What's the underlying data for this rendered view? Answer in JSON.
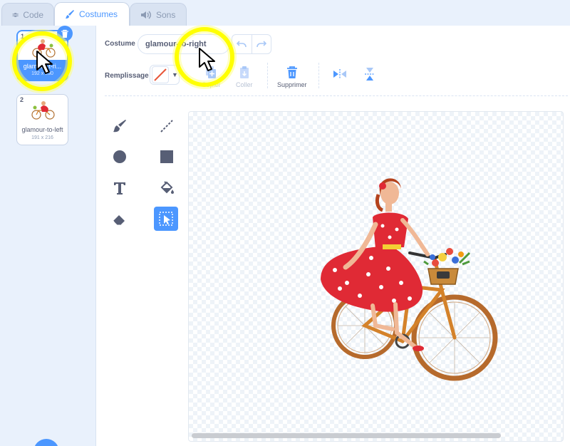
{
  "tabs": [
    {
      "label": "Code",
      "icon": "code-icon"
    },
    {
      "label": "Costumes",
      "icon": "brush-icon",
      "active": true
    },
    {
      "label": "Sons",
      "icon": "speaker-icon"
    }
  ],
  "costumes": [
    {
      "number": "1",
      "label": "glamour-t-ri...",
      "size": "192 x 230",
      "selected": true
    },
    {
      "number": "2",
      "label": "glamour-to-left",
      "size": "191 x 216",
      "selected": false
    }
  ],
  "editor": {
    "costume_label": "Costume",
    "costume_name": "glamour-to-right",
    "fill_label": "Remplissage",
    "fill_color": "#e8573b",
    "copy_label": "Copier",
    "paste_label": "Coller",
    "delete_label": "Supprimer"
  },
  "colors": {
    "accent": "#4c97ff",
    "highlight": "#ffff00"
  }
}
